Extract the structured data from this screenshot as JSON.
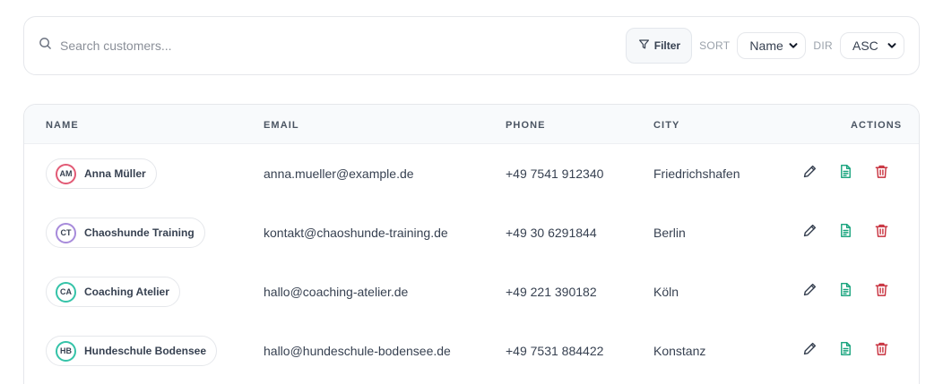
{
  "toolbar": {
    "search_placeholder": "Search customers...",
    "filter_label": "Filter",
    "sort_label": "SORT",
    "sort_value": "Name",
    "dir_label": "DIR",
    "dir_value": "ASC"
  },
  "table": {
    "headers": {
      "name": "NAME",
      "email": "EMAIL",
      "phone": "PHONE",
      "city": "CITY",
      "actions": "ACTIONS"
    },
    "rows": [
      {
        "initials": "AM",
        "name": "Anna Müller",
        "email": "anna.mueller@example.de",
        "phone": "+49 7541 912340",
        "city": "Friedrichshafen",
        "avatar_color": "#e25a75"
      },
      {
        "initials": "CT",
        "name": "Chaoshunde Training",
        "email": "kontakt@chaoshunde-training.de",
        "phone": "+49 30 6291844",
        "city": "Berlin",
        "avatar_color": "#a78bdb"
      },
      {
        "initials": "CA",
        "name": "Coaching Atelier",
        "email": "hallo@coaching-atelier.de",
        "phone": "+49 221 390182",
        "city": "Köln",
        "avatar_color": "#34c3a8"
      },
      {
        "initials": "HB",
        "name": "Hundeschule Bodensee",
        "email": "hallo@hundeschule-bodensee.de",
        "phone": "+49 7531 884422",
        "city": "Konstanz",
        "avatar_color": "#34c3a8"
      }
    ]
  },
  "colors": {
    "edit_icon": "#374151",
    "document_icon": "#16a37c",
    "delete_icon": "#c8313e"
  },
  "icons": [
    "search-icon",
    "filter-icon",
    "chevron-down-icon",
    "pencil-icon",
    "document-icon",
    "trash-icon"
  ]
}
